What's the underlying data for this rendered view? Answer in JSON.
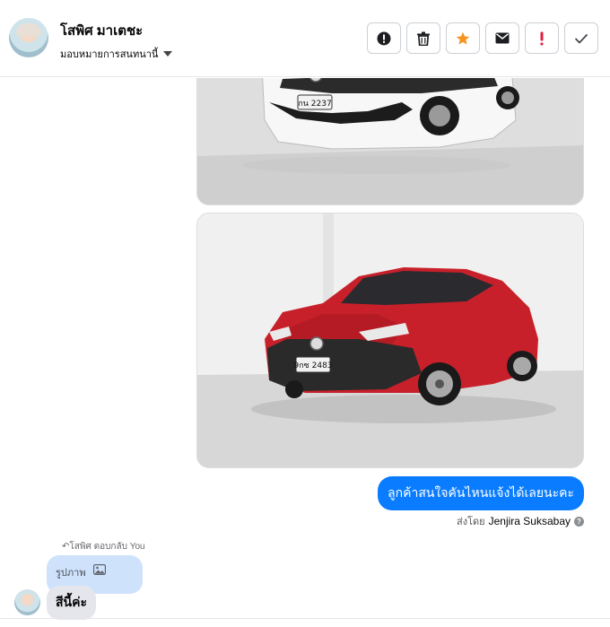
{
  "header": {
    "name": "โสพิศ มาเตชะ",
    "assign_label": "มอบหมายการสนทนานี้",
    "actions": [
      {
        "name": "mark-spam",
        "icon": "exclamation-circle-icon"
      },
      {
        "name": "delete",
        "icon": "trash-icon"
      },
      {
        "name": "star",
        "icon": "star-icon"
      },
      {
        "name": "mark-unread",
        "icon": "envelope-icon"
      },
      {
        "name": "follow-up",
        "icon": "red-exclamation-icon"
      },
      {
        "name": "done",
        "icon": "check-icon"
      }
    ]
  },
  "thread": {
    "photos": [
      {
        "plate": "กน 2237",
        "car_color": "#ffffff"
      },
      {
        "plate": "9กซ 2483",
        "car_color": "#d3202a"
      }
    ],
    "outgoing_message": "ลูกค้าสนใจคันไหนแจ้งได้เลยนะคะ",
    "sent_by_prefix": "ส่งโดย",
    "sent_by_name": "Jenjira Suksabay",
    "reply_note": "โสพิศ ตอบกลับ You",
    "quoted_label": "รูปภาพ",
    "incoming_message": "สีนี้ค่ะ"
  },
  "colors": {
    "accent": "#0a7cff",
    "star": "#f7931e",
    "alert": "#e41e3f"
  }
}
